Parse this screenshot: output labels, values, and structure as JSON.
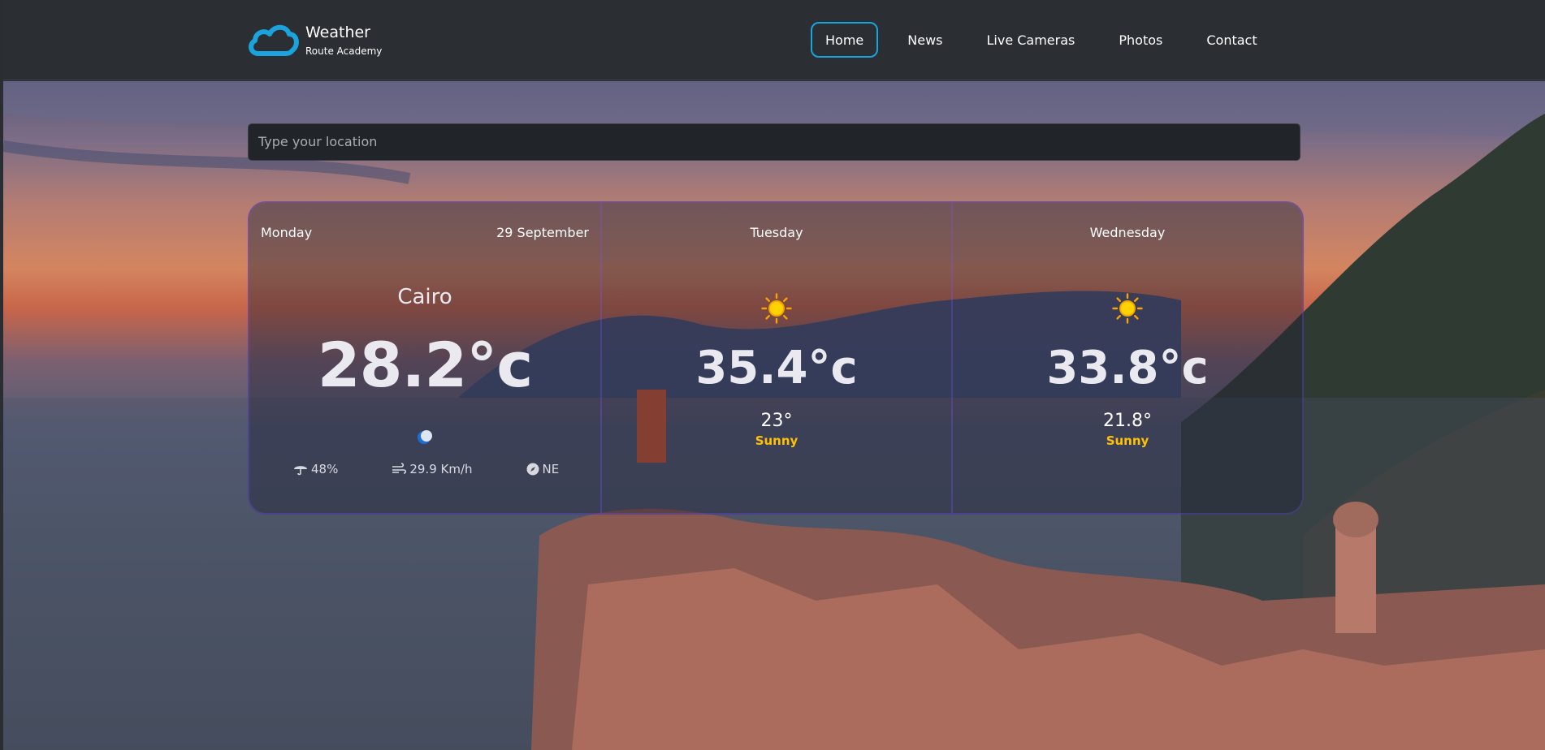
{
  "brand": {
    "title": "Weather",
    "subtitle": "Route Academy",
    "icon": "cloud-icon",
    "accent": "#1aa3de"
  },
  "nav": {
    "items": [
      {
        "label": "Home",
        "active": true
      },
      {
        "label": "News",
        "active": false
      },
      {
        "label": "Live Cameras",
        "active": false
      },
      {
        "label": "Photos",
        "active": false
      },
      {
        "label": "Contact",
        "active": false
      }
    ]
  },
  "search": {
    "placeholder": "Type your location"
  },
  "today": {
    "day": "Monday",
    "date": "29 September",
    "city": "Cairo",
    "temp": "28.2°c",
    "icon": "moon-icon",
    "humidity": "48%",
    "wind_speed": "29.9 Km/h",
    "wind_dir": "NE"
  },
  "forecast": [
    {
      "day": "Tuesday",
      "icon": "sun-icon",
      "max": "35.4°c",
      "min": "23°",
      "condition": "Sunny"
    },
    {
      "day": "Wednesday",
      "icon": "sun-icon",
      "max": "33.8°c",
      "min": "21.8°",
      "condition": "Sunny"
    }
  ],
  "colors": {
    "condition": "#ffc107",
    "card_border": "#503caa"
  }
}
